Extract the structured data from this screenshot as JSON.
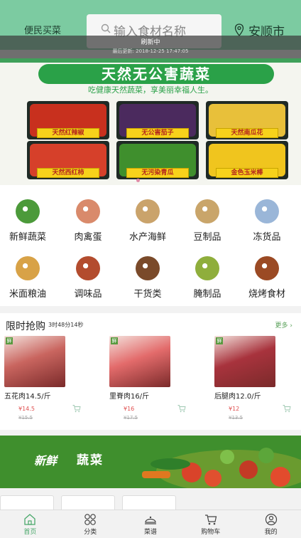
{
  "header": {
    "brand": "便民买菜",
    "search_placeholder": "输入食材名称",
    "location": "安顺市"
  },
  "refresh": {
    "title": "刷新中",
    "time": "最后更新: 2018-12-25 17:47:05"
  },
  "banner": {
    "title": "天然无公害蔬菜",
    "slogan": "吃健康天然蔬菜，享美丽幸福人生。",
    "items": [
      {
        "label": "天然红辣椒",
        "color": "#c8301e"
      },
      {
        "label": "无公害茄子",
        "color": "#4b2a5e"
      },
      {
        "label": "天然南瓜花",
        "color": "#e8c03a"
      },
      {
        "label": "天然西红柿",
        "color": "#d6402a"
      },
      {
        "label": "无污染青瓜",
        "color": "#3f8f2d"
      },
      {
        "label": "金色玉米棒",
        "color": "#f0c51e"
      }
    ]
  },
  "categories": [
    {
      "label": "新鲜蔬菜",
      "icon": "vegetables-icon",
      "color": "#4c9a3a"
    },
    {
      "label": "肉禽蛋",
      "icon": "meat-icon",
      "color": "#d98a6b"
    },
    {
      "label": "水产海鲜",
      "icon": "seafood-icon",
      "color": "#caa36b"
    },
    {
      "label": "豆制品",
      "icon": "tofu-icon",
      "color": "#c9a56a"
    },
    {
      "label": "冻货品",
      "icon": "frozen-icon",
      "color": "#9ab6d8"
    },
    {
      "label": "米面粮油",
      "icon": "grain-oil-icon",
      "color": "#d8a247"
    },
    {
      "label": "调味品",
      "icon": "seasoning-icon",
      "color": "#b34c2e"
    },
    {
      "label": "干货类",
      "icon": "dried-goods-icon",
      "color": "#7a4a2a"
    },
    {
      "label": "腌制品",
      "icon": "pickled-icon",
      "color": "#8fae3c"
    },
    {
      "label": "烧烤食材",
      "icon": "bbq-icon",
      "color": "#9b4a24"
    }
  ],
  "flash_sale": {
    "title": "限时抢购",
    "timer": "3时48分14秒",
    "more": "更多",
    "products": [
      {
        "name": "五花肉14.5/斤",
        "price": "¥14.5",
        "original": "¥15.5",
        "color": "#c9655f"
      },
      {
        "name": "里脊肉16/斤",
        "price": "¥16",
        "original": "¥17.5",
        "color": "#e36b6b"
      },
      {
        "name": "后腿肉12.0/斤",
        "price": "¥12",
        "original": "¥13.5",
        "color": "#a8333d"
      }
    ]
  },
  "promo": {
    "text1": "新鲜",
    "text2": "蔬菜"
  },
  "tabs": [
    {
      "label": "首页",
      "icon": "home-icon"
    },
    {
      "label": "分类",
      "icon": "category-icon"
    },
    {
      "label": "菜谱",
      "icon": "recipe-icon"
    },
    {
      "label": "购物车",
      "icon": "cart-icon"
    },
    {
      "label": "我的",
      "icon": "user-icon"
    }
  ],
  "colors": {
    "header": "#7ccba1",
    "accent": "#4aa86b",
    "price": "#e05050"
  }
}
